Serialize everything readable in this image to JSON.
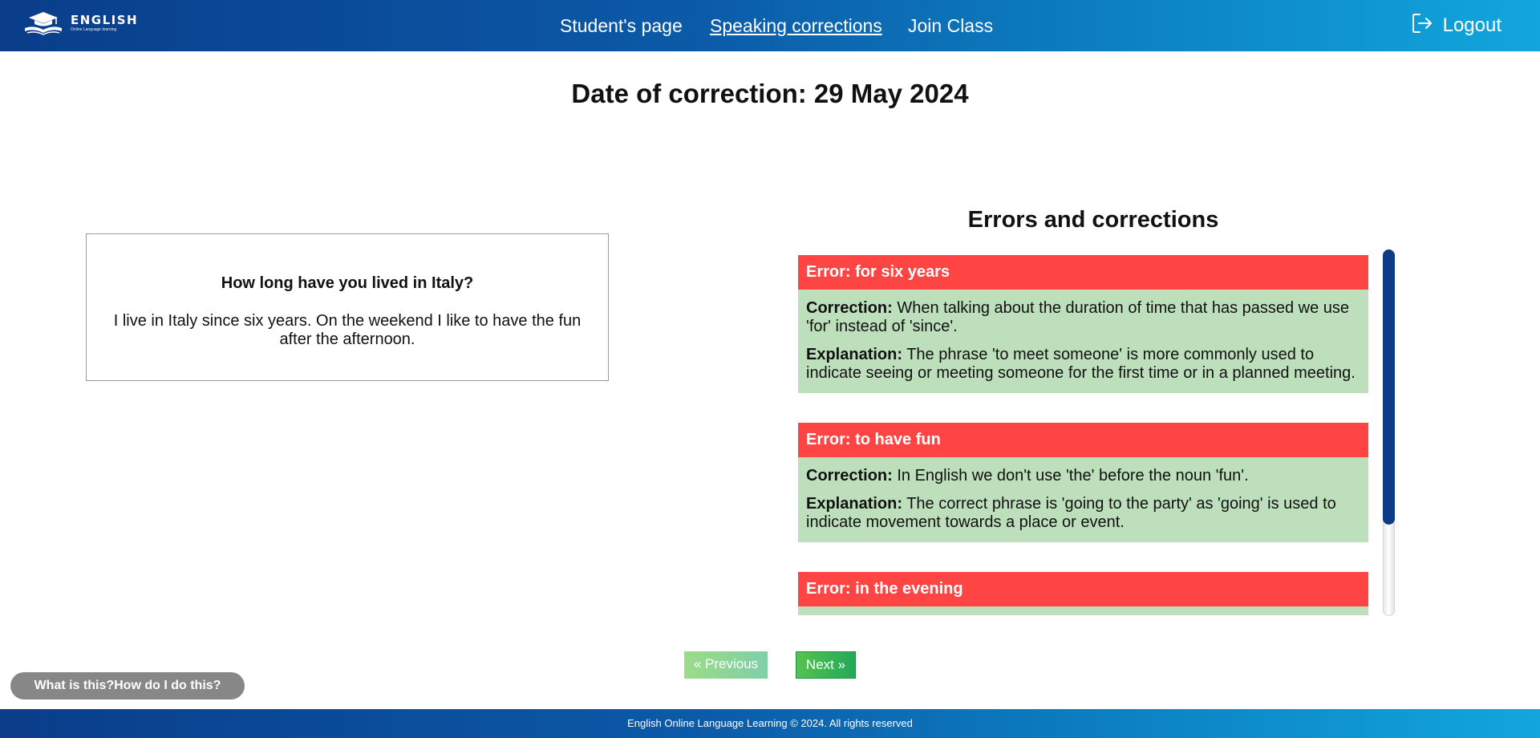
{
  "header": {
    "logo_title": "ENGLISH",
    "logo_subtitle": "Online Language learning",
    "logo_icon": "graduation-cap-book-icon",
    "nav": [
      {
        "label": "Student's page",
        "active": false
      },
      {
        "label": "Speaking corrections",
        "active": true
      },
      {
        "label": "Join Class",
        "active": false
      }
    ],
    "logout_label": "Logout",
    "logout_icon": "logout-icon"
  },
  "page": {
    "title": "Date of correction: 29 May 2024"
  },
  "qa": {
    "question": "How long have you lived in Italy?",
    "answer": "I live in Italy since six years. On the weekend I like to have the fun after the afternoon."
  },
  "errors": {
    "title": "Errors and corrections",
    "correction_label": "Correction:",
    "explanation_label": "Explanation:",
    "items": [
      {
        "error": "Error: for six years",
        "correction": "When talking about the duration of time that has passed we use 'for' instead of 'since'.",
        "explanation": "The phrase 'to meet someone' is more commonly used to indicate seeing or meeting someone for the first time or in a planned meeting."
      },
      {
        "error": "Error: to have fun",
        "correction": "In English we don't use 'the' before the noun 'fun'.",
        "explanation": "The correct phrase is 'going to the party' as 'going' is used to indicate movement towards a place or event."
      },
      {
        "error": "Error: in the evening",
        "correction": "",
        "explanation": ""
      }
    ]
  },
  "pagination": {
    "previous_label": "« Previous",
    "next_label": "Next »"
  },
  "help": {
    "label": "What is this?How do I do this?"
  },
  "footer": {
    "text": "English Online Language Learning © 2024. All rights reserved"
  },
  "colors": {
    "header_gradient_start": "#0a3d8a",
    "header_gradient_end": "#12a6dc",
    "error_header": "#ff4444",
    "correction_body": "#bedfbc",
    "next_button": "#3cb552",
    "scroll_thumb": "#0d3b87"
  }
}
